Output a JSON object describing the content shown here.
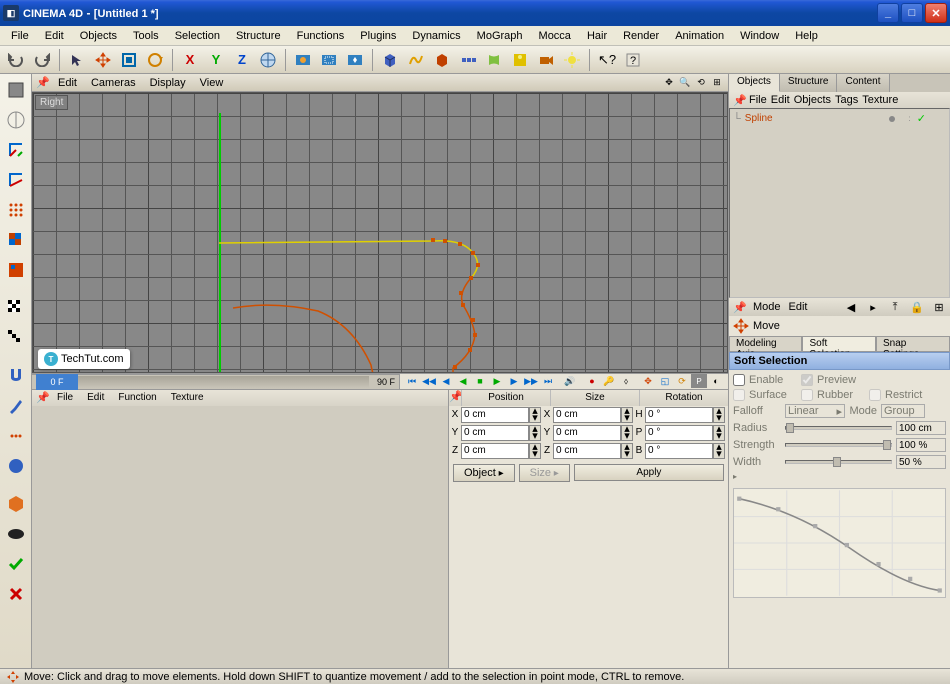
{
  "titlebar": {
    "app": "CINEMA 4D",
    "doc": "[Untitled 1 *]"
  },
  "menu": [
    "File",
    "Edit",
    "Objects",
    "Tools",
    "Selection",
    "Structure",
    "Functions",
    "Plugins",
    "Dynamics",
    "MoGraph",
    "Mocca",
    "Hair",
    "Render",
    "Animation",
    "Window",
    "Help"
  ],
  "viewport": {
    "menu": [
      "Edit",
      "Cameras",
      "Display",
      "View"
    ],
    "label": "Right",
    "axis_y": "Y",
    "axis_z": "Z",
    "watermark": "TechTut.com"
  },
  "timeline": {
    "start": "0 F",
    "end": "90 F"
  },
  "materials": {
    "menu": [
      "File",
      "Edit",
      "Function",
      "Texture"
    ]
  },
  "coords": {
    "headers": [
      "Position",
      "Size",
      "Rotation"
    ],
    "rows": [
      {
        "l": "X",
        "p": "0 cm",
        "s": "0 cm",
        "rl": "H",
        "r": "0 °"
      },
      {
        "l": "Y",
        "p": "0 cm",
        "s": "0 cm",
        "rl": "P",
        "r": "0 °"
      },
      {
        "l": "Z",
        "p": "0 cm",
        "s": "0 cm",
        "rl": "B",
        "r": "0 °"
      }
    ],
    "foot": {
      "object": "Object",
      "size": "Size",
      "apply": "Apply"
    }
  },
  "objects": {
    "tabs": [
      "Objects",
      "Structure",
      "Content"
    ],
    "menu": [
      "File",
      "Edit",
      "Objects",
      "Tags",
      "Texture"
    ],
    "tree": [
      {
        "name": "Spline"
      }
    ]
  },
  "modebar": {
    "mode": "Mode",
    "edit": "Edit"
  },
  "attr": {
    "tool": "Move",
    "tabs": [
      "Modeling Axis",
      "Soft Selection",
      "Snap Settings"
    ],
    "section": "Soft Selection",
    "enable": "Enable",
    "preview": "Preview",
    "surface": "Surface",
    "rubber": "Rubber",
    "restrict": "Restrict",
    "falloff": "Falloff",
    "falloff_v": "Linear",
    "mode": "Mode",
    "mode_v": "Group",
    "radius": "Radius",
    "radius_v": "100 cm",
    "strength": "Strength",
    "strength_v": "100 %",
    "width": "Width",
    "width_v": "50 %"
  },
  "status": "Move: Click and drag to move elements. Hold down SHIFT to quantize movement / add to the selection in point mode, CTRL to remove."
}
